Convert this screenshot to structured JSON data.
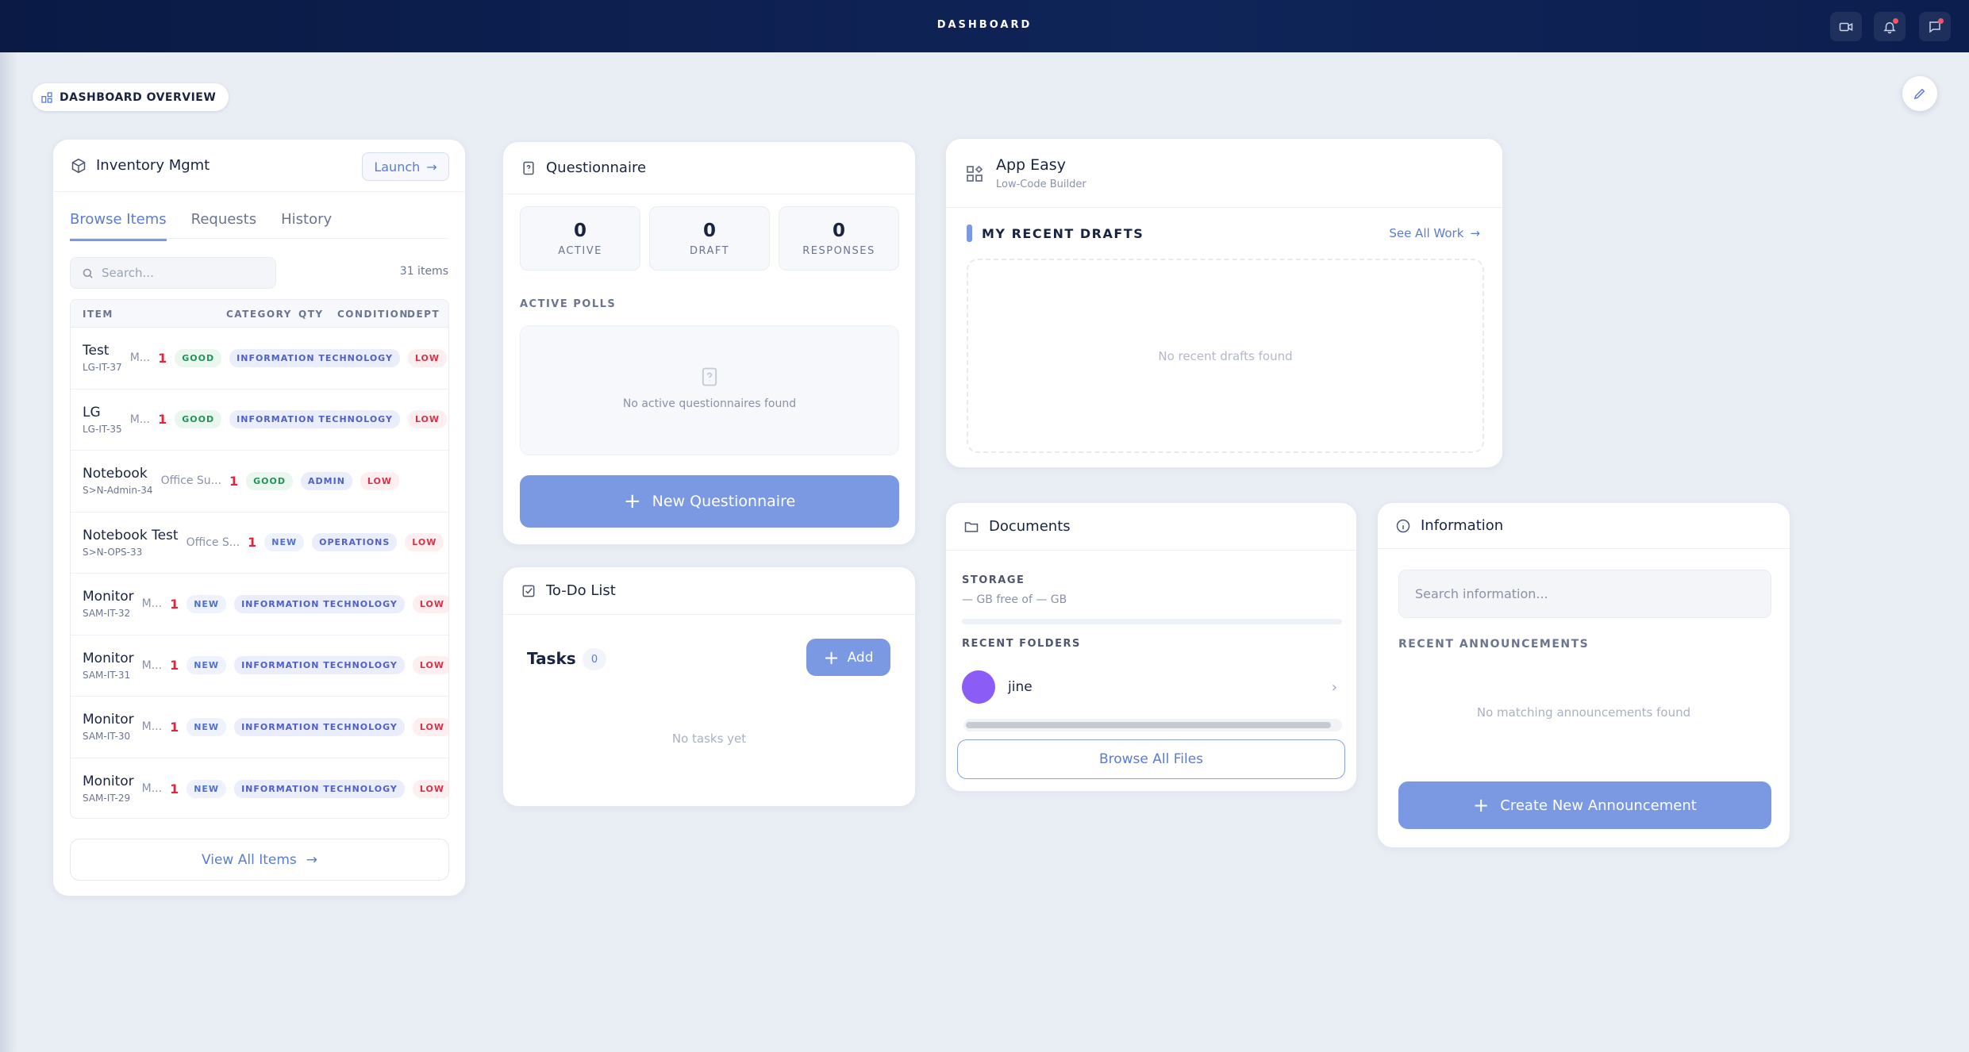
{
  "topbar": {
    "title": "DASHBOARD"
  },
  "overview": {
    "label": "DASHBOARD OVERVIEW"
  },
  "inventory": {
    "title": "Inventory Mgmt",
    "launch_label": "Launch",
    "tabs": [
      "Browse Items",
      "Requests",
      "History"
    ],
    "search_placeholder": "Search...",
    "count": "31 items",
    "columns": [
      "ITEM",
      "CATEGORY",
      "QTY",
      "CONDITION",
      "DEPT"
    ],
    "rows": [
      {
        "name": "Test",
        "code": "LG-IT-37",
        "category": "M...",
        "qty": "1",
        "condition": "GOOD",
        "dept": "INFORMATION TECHNOLOGY",
        "priority": "LOW"
      },
      {
        "name": "LG",
        "code": "LG-IT-35",
        "category": "M...",
        "qty": "1",
        "condition": "GOOD",
        "dept": "INFORMATION TECHNOLOGY",
        "priority": "LOW"
      },
      {
        "name": "Notebook",
        "code": "S>N-Admin-34",
        "category": "Office Su...",
        "qty": "1",
        "condition": "GOOD",
        "dept": "ADMIN",
        "priority": "LOW"
      },
      {
        "name": "Notebook Test",
        "code": "S>N-OPS-33",
        "category": "Office S...",
        "qty": "1",
        "condition": "NEW",
        "dept": "OPERATIONS",
        "priority": "LOW"
      },
      {
        "name": "Monitor",
        "code": "SAM-IT-32",
        "category": "M...",
        "qty": "1",
        "condition": "NEW",
        "dept": "INFORMATION TECHNOLOGY",
        "priority": "LOW"
      },
      {
        "name": "Monitor",
        "code": "SAM-IT-31",
        "category": "M...",
        "qty": "1",
        "condition": "NEW",
        "dept": "INFORMATION TECHNOLOGY",
        "priority": "LOW"
      },
      {
        "name": "Monitor",
        "code": "SAM-IT-30",
        "category": "M...",
        "qty": "1",
        "condition": "NEW",
        "dept": "INFORMATION TECHNOLOGY",
        "priority": "LOW"
      },
      {
        "name": "Monitor",
        "code": "SAM-IT-29",
        "category": "M...",
        "qty": "1",
        "condition": "NEW",
        "dept": "INFORMATION TECHNOLOGY",
        "priority": "LOW"
      }
    ],
    "view_all_label": "View All Items"
  },
  "questionnaire": {
    "title": "Questionnaire",
    "stats": [
      {
        "value": "0",
        "label": "ACTIVE"
      },
      {
        "value": "0",
        "label": "DRAFT"
      },
      {
        "value": "0",
        "label": "RESPONSES"
      }
    ],
    "polls_label": "ACTIVE POLLS",
    "empty_text": "No active questionnaires found",
    "new_label": "New Questionnaire"
  },
  "todo": {
    "title": "To-Do List",
    "tasks_label": "Tasks",
    "tasks_count": "0",
    "add_label": "Add",
    "empty_text": "No tasks yet"
  },
  "appeasy": {
    "title": "App Easy",
    "subtitle": "Low-Code Builder",
    "drafts_label": "MY RECENT DRAFTS",
    "see_all_label": "See All Work",
    "empty_text": "No recent drafts found"
  },
  "documents": {
    "title": "Documents",
    "storage_label": "STORAGE",
    "storage_value": "— GB free of — GB",
    "folders_label": "RECENT FOLDERS",
    "folders": [
      {
        "name": "jine"
      }
    ],
    "browse_label": "Browse All Files"
  },
  "information": {
    "title": "Information",
    "search_placeholder": "Search information...",
    "announcements_label": "RECENT ANNOUNCEMENTS",
    "empty_text": "No matching announcements found",
    "create_label": "Create New Announcement"
  },
  "colors": {
    "accent": "#7b98e3",
    "topbar": "#0f2458",
    "danger": "#e0263c",
    "folder_avatar": "#8b5cf6"
  }
}
